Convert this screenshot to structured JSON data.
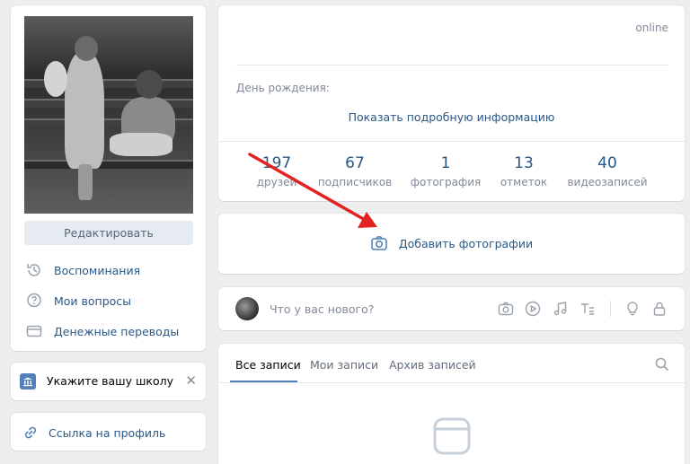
{
  "profile": {
    "edit_label": "Редактировать",
    "menu": [
      {
        "icon": "history-icon",
        "label": "Воспоминания"
      },
      {
        "icon": "question-icon",
        "label": "Мои вопросы"
      },
      {
        "icon": "wallet-icon",
        "label": "Денежные переводы"
      }
    ]
  },
  "school_prompt": {
    "icon": "school-icon",
    "label": "Укажите вашу школу",
    "close": "✕"
  },
  "profile_link": {
    "icon": "link-icon",
    "label": "Ссылка на профиль"
  },
  "info": {
    "status": "online",
    "birthday_label": "День рождения:",
    "show_more": "Показать подробную информацию",
    "counters": [
      {
        "value": "197",
        "label": "друзей"
      },
      {
        "value": "67",
        "label": "подписчиков"
      },
      {
        "value": "1",
        "label": "фотография"
      },
      {
        "value": "13",
        "label": "отметок"
      },
      {
        "value": "40",
        "label": "видеозаписей"
      }
    ]
  },
  "add_photos": {
    "icon": "camera-icon",
    "label": "Добавить фотографии"
  },
  "post_box": {
    "placeholder": "Что у вас нового?",
    "tools": [
      "camera-icon",
      "video-icon",
      "music-icon",
      "text-icon",
      "bulb-icon",
      "lock-icon"
    ]
  },
  "wall": {
    "tabs": [
      "Все записи",
      "Мои записи",
      "Архив записей"
    ],
    "active_tab": "Все записи",
    "search_icon": "search-icon",
    "empty_icon": "empty-wall-icon"
  },
  "colors": {
    "background": "#edeef0",
    "link": "#2a5885",
    "muted": "#828a99",
    "accent": "#5181b8",
    "arrow": "#e32222"
  }
}
